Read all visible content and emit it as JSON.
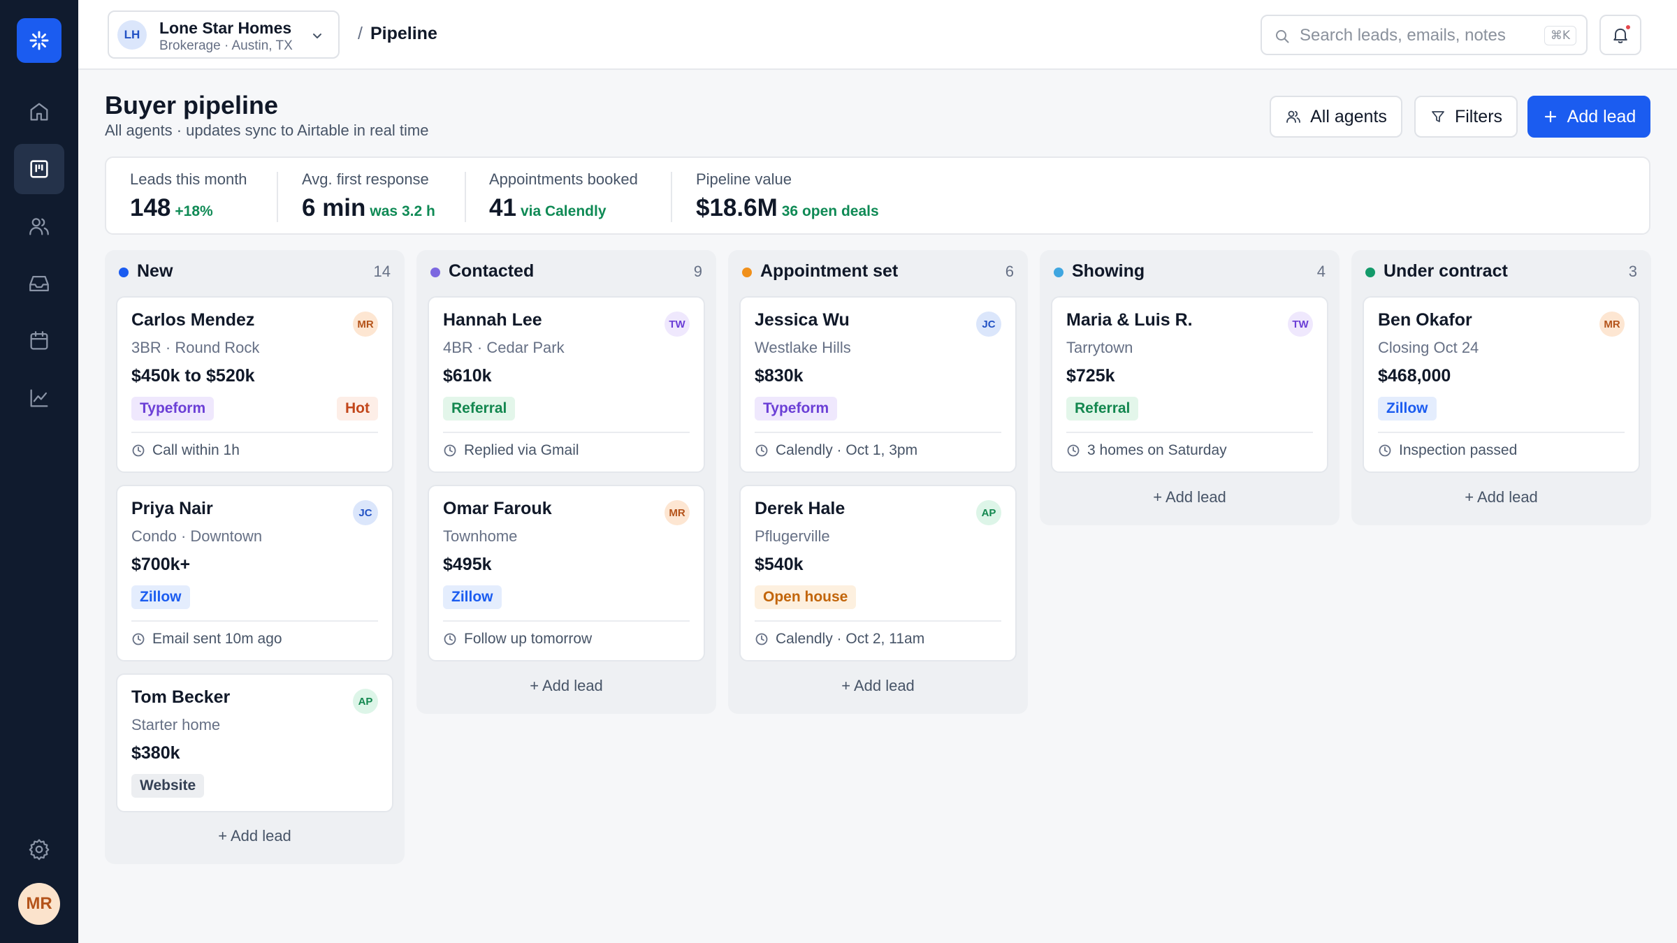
{
  "workspace": {
    "initials": "LH",
    "name": "Lone Star Homes",
    "subtitle": "Brokerage · Austin, TX"
  },
  "breadcrumb": {
    "separator": "/",
    "current": "Pipeline"
  },
  "search": {
    "placeholder": "Search leads, emails, notes",
    "shortcut": "⌘K"
  },
  "user": {
    "initials": "MR"
  },
  "page": {
    "title": "Buyer pipeline",
    "subtitle": "All agents · updates sync to Airtable in real time"
  },
  "actions": {
    "agents": "All agents",
    "filters": "Filters",
    "add": "Add lead"
  },
  "stats": [
    {
      "label": "Leads this month",
      "value": "148",
      "note": "+18%"
    },
    {
      "label": "Avg. first response",
      "value": "6 min",
      "note": "was 3.2 h"
    },
    {
      "label": "Appointments booked",
      "value": "41",
      "note": "via Calendly"
    },
    {
      "label": "Pipeline value",
      "value": "$18.6M",
      "note": "36 open deals"
    }
  ],
  "colors": {
    "accent": "#1b5cf0",
    "sidebar": "#101b2e"
  },
  "columns": [
    {
      "title": "New",
      "count": "14",
      "color": "#1b5cf0",
      "add_label": "Add lead",
      "cards": [
        {
          "name": "Carlos Mendez",
          "sub": "3BR · Round Rock",
          "price": "$450k to $520k",
          "agent": "MR",
          "tag": "Typeform",
          "extra_tag": "Hot",
          "footer": "Call within 1h"
        },
        {
          "name": "Priya Nair",
          "sub": "Condo · Downtown",
          "price": "$700k+",
          "agent": "JC",
          "tag": "Zillow",
          "footer": "Email sent 10m ago"
        },
        {
          "name": "Tom Becker",
          "sub": "Starter home",
          "price": "$380k",
          "agent": "AP",
          "tag": "Website"
        }
      ]
    },
    {
      "title": "Contacted",
      "count": "9",
      "color": "#7c68e0",
      "add_label": "Add lead",
      "cards": [
        {
          "name": "Hannah Lee",
          "sub": "4BR · Cedar Park",
          "price": "$610k",
          "agent": "TW",
          "tag": "Referral",
          "footer": "Replied via Gmail"
        },
        {
          "name": "Omar Farouk",
          "sub": "Townhome",
          "price": "$495k",
          "agent": "MR",
          "tag": "Zillow",
          "footer": "Follow up tomorrow"
        }
      ]
    },
    {
      "title": "Appointment set",
      "count": "6",
      "color": "#f0901b",
      "add_label": "Add lead",
      "cards": [
        {
          "name": "Jessica Wu",
          "sub": "Westlake Hills",
          "price": "$830k",
          "agent": "JC",
          "tag": "Typeform",
          "footer": "Calendly · Oct 1, 3pm"
        },
        {
          "name": "Derek Hale",
          "sub": "Pflugerville",
          "price": "$540k",
          "agent": "AP",
          "tag": "Open house",
          "footer": "Calendly · Oct 2, 11am"
        }
      ]
    },
    {
      "title": "Showing",
      "count": "4",
      "color": "#3fa6e0",
      "add_label": "Add lead",
      "cards": [
        {
          "name": "Maria & Luis R.",
          "sub": "Tarrytown",
          "price": "$725k",
          "agent": "TW",
          "tag": "Referral",
          "footer": "3 homes on Saturday"
        }
      ]
    },
    {
      "title": "Under contract",
      "count": "3",
      "color": "#139a6a",
      "add_label": "Add lead",
      "cards": [
        {
          "name": "Ben Okafor",
          "sub": "Closing Oct 24",
          "price": "$468,000",
          "agent": "MR",
          "tag": "Zillow",
          "footer": "Inspection passed"
        }
      ]
    }
  ]
}
